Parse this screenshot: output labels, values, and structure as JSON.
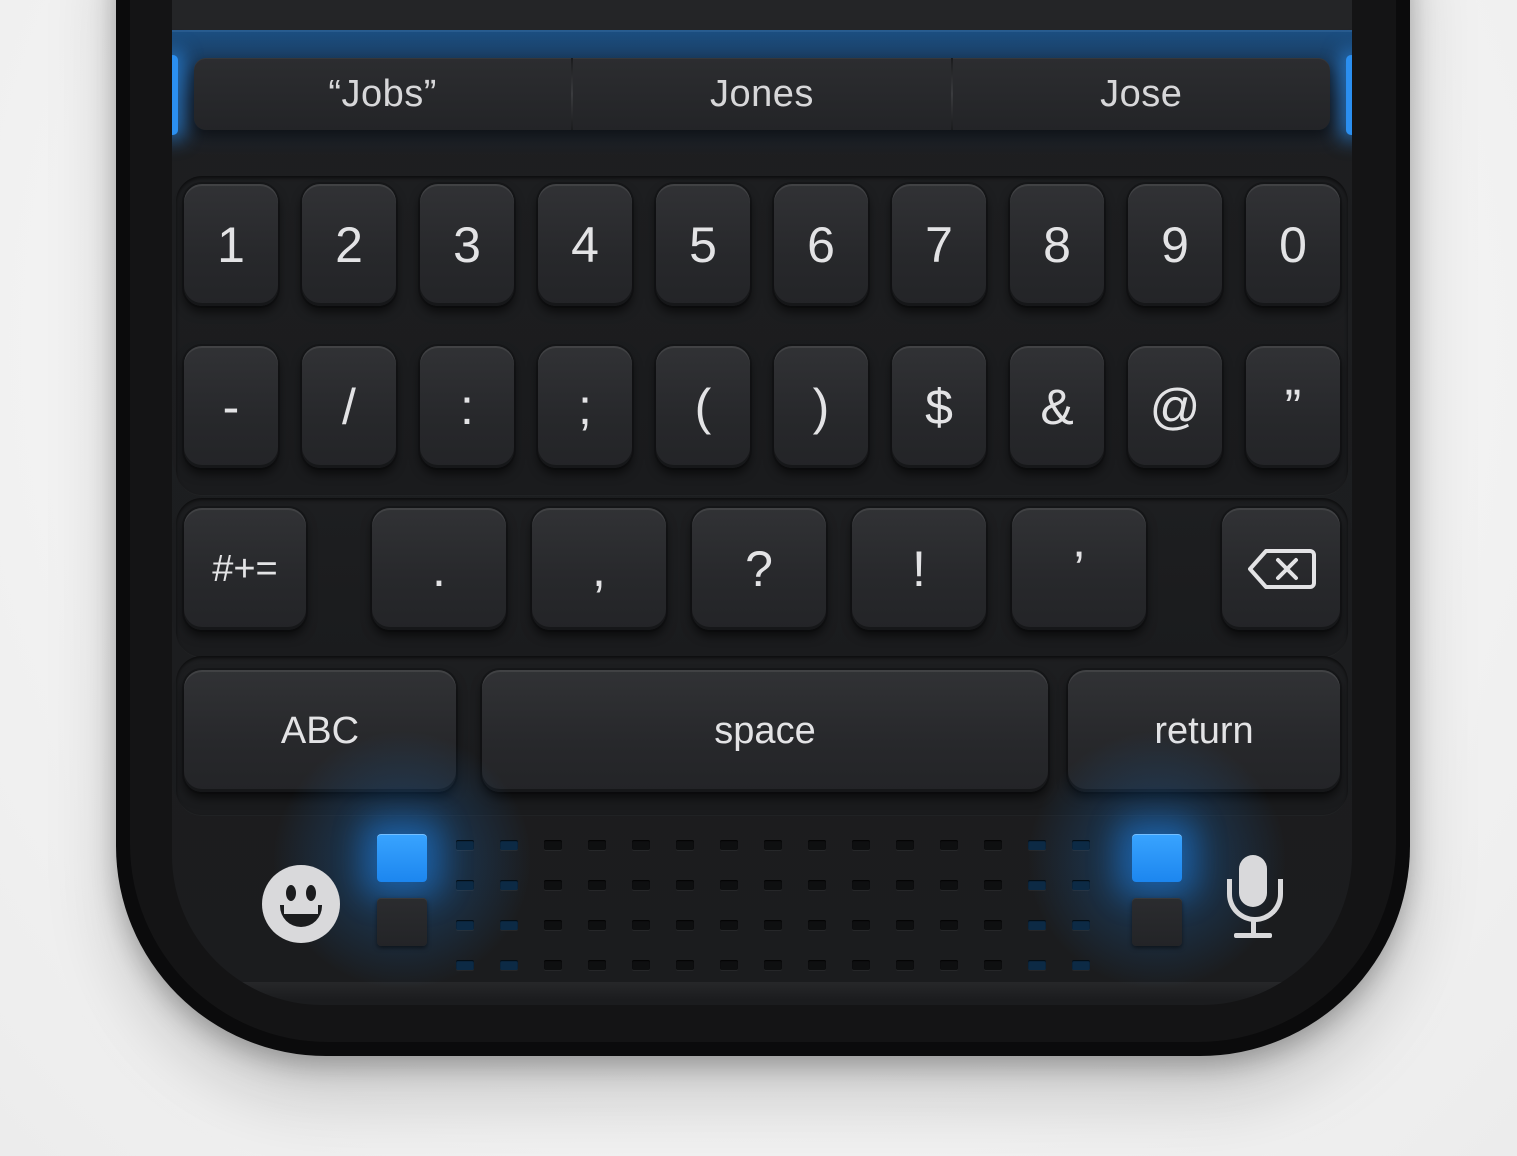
{
  "suggestions": {
    "items": [
      "“Jobs”",
      "Jones",
      "Jose"
    ]
  },
  "keyboard": {
    "number_row": [
      "1",
      "2",
      "3",
      "4",
      "5",
      "6",
      "7",
      "8",
      "9",
      "0"
    ],
    "symbol_row": [
      "-",
      "/",
      ":",
      ";",
      "(",
      ")",
      "$",
      "&",
      "@",
      "”"
    ],
    "punct_row": [
      ".",
      ",",
      "?",
      "!",
      "’"
    ],
    "more_symbols_label": "#+=",
    "delete_icon": "delete-backspace-icon",
    "abc_label": "ABC",
    "space_label": "space",
    "return_label": "return"
  },
  "bottom_bar": {
    "emoji_icon": "emoji-face-icon",
    "mic_icon": "microphone-icon"
  },
  "colors": {
    "accent_blue": "#1c86ef",
    "key_face": "#2a2b2e",
    "key_text": "#e3e3e5",
    "phone_frame": "#0b0b0c"
  }
}
